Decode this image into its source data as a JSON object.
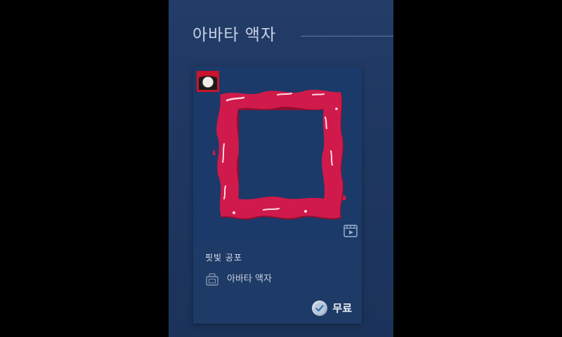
{
  "section": {
    "title": "아바타 액자"
  },
  "card": {
    "item_name": "핏빛 공포",
    "type_icon": "frame-icon",
    "type_label": "아바타 액자",
    "badge_icon": "moon-badge-icon",
    "preview_icon": "video-preview-icon",
    "price_icon": "steam-points-icon",
    "price_label": "무료"
  },
  "colors": {
    "panel_bg": "#1f3862",
    "blood": "#d01a4b",
    "blood_dark": "#8e0f31",
    "text": "#c9d3e6"
  }
}
